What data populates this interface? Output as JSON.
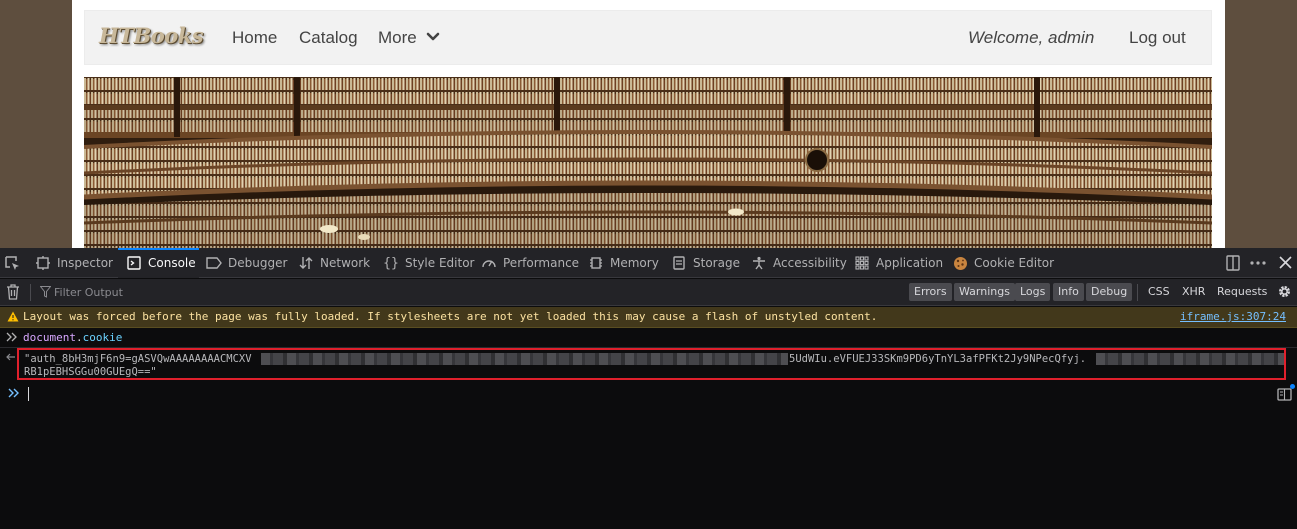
{
  "site": {
    "logo": "HTBooks",
    "nav": {
      "home": "Home",
      "catalog": "Catalog",
      "more": "More",
      "welcome": "Welcome, admin",
      "logout": "Log out"
    }
  },
  "devtools": {
    "tabs": [
      {
        "label": "Inspector",
        "icon": "inspector-icon"
      },
      {
        "label": "Console",
        "icon": "console-icon",
        "active": true
      },
      {
        "label": "Debugger",
        "icon": "debugger-icon"
      },
      {
        "label": "Network",
        "icon": "network-icon"
      },
      {
        "label": "Style Editor",
        "icon": "style-editor-icon"
      },
      {
        "label": "Performance",
        "icon": "performance-icon"
      },
      {
        "label": "Memory",
        "icon": "memory-icon"
      },
      {
        "label": "Storage",
        "icon": "storage-icon"
      },
      {
        "label": "Accessibility",
        "icon": "accessibility-icon"
      },
      {
        "label": "Application",
        "icon": "application-icon"
      },
      {
        "label": "Cookie Editor",
        "icon": "cookie-icon"
      }
    ],
    "filter": {
      "placeholder": "Filter Output",
      "levels": [
        "Errors",
        "Warnings",
        "Logs",
        "Info",
        "Debug"
      ],
      "requests": [
        "CSS",
        "XHR",
        "Requests"
      ]
    },
    "accent_color": "#0a84ff",
    "console": {
      "warning": {
        "text": "Layout was forced before the page was fully loaded. If stylesheets are not yet loaded this may cause a flash of unstyled content.",
        "source": "iframe.js:307:24"
      },
      "input": {
        "object": "document",
        "dot": ".",
        "property": "cookie"
      },
      "output": {
        "line1_start": "\"auth_8bH3mjF6n9=gASVQwAAAAAAAACMCXV",
        "line1_end": "5UdWIu.eVFUEJ33SKm9PD6yTnYL3afPFKt2Jy9NPecQfyj.",
        "line2": "RB1pEBHSGGu00GUEgQ==\""
      },
      "highlight_color": "#e0202c"
    }
  }
}
